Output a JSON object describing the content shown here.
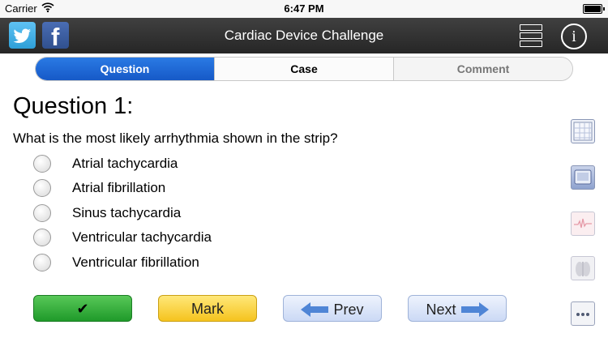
{
  "status_bar": {
    "carrier": "Carrier",
    "time": "6:47 PM"
  },
  "nav": {
    "title": "Cardiac Device Challenge",
    "facebook_glyph": "f",
    "info_glyph": "i",
    "icons": [
      "twitter-icon",
      "facebook-icon",
      "menu-list-icon",
      "info-icon"
    ]
  },
  "tabs": [
    {
      "label": "Question",
      "selected": true
    },
    {
      "label": "Case",
      "selected": false
    },
    {
      "label": "Comment",
      "selected": false
    }
  ],
  "question": {
    "heading": "Question 1:",
    "text": "What is the most likely arrhythmia shown in the strip?",
    "options": [
      "Atrial tachycardia",
      "Atrial fibrillation",
      "Sinus tachycardia",
      "Ventricular tachycardia",
      "Ventricular fibrillation"
    ]
  },
  "buttons": {
    "check_glyph": "✔",
    "mark": "Mark",
    "prev": "Prev",
    "next": "Next"
  },
  "side_icons": [
    "ecg-grid-icon",
    "monitor-icon",
    "waveform-icon",
    "chest-xray-icon",
    "more-icon"
  ],
  "colors": {
    "nav_bg": "#2e2e2e",
    "tab_active": "#1f6fdc",
    "check_button": "#2fae36",
    "mark_button": "#f8d240",
    "nav_button": "#dbe5f8",
    "arrow_blue": "#4f85d6"
  }
}
